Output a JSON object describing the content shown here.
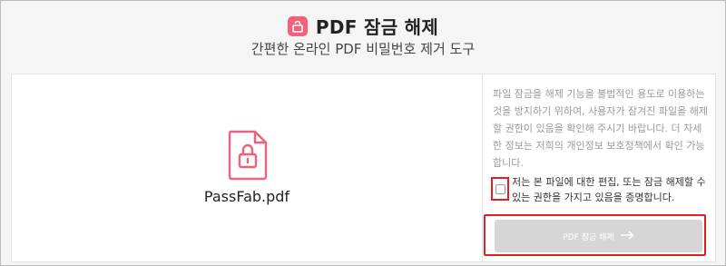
{
  "header": {
    "title": "PDF 잠금 해제",
    "subtitle": "간편한 온라인 PDF 비밀번호 제거 도구"
  },
  "file": {
    "name": "PassFab.pdf",
    "icon": "pdf-lock-icon"
  },
  "sidebar": {
    "notice": "파일 잠금을 해제 기능을 불법적인 용도로 이용하는 것을 방지하기 위하여, 사용자가 잠겨진 파일을 해제할 권한이 있음을 확인해 주시기 바랍니다. 더 자세한 정보는 저희의 개인정보 보호정책에서 확인 가능합니다.",
    "agree_label": "저는 본 파일에 대한 편집, 또는 잠금 해제할 수 있는 권한을 가지고 있음을 증명합니다.",
    "agree_checked": false,
    "button_label": "PDF 잠금 해제"
  },
  "colors": {
    "accent": "#f2607c",
    "highlight": "#e02020",
    "button_disabled": "#d6d6d6"
  }
}
